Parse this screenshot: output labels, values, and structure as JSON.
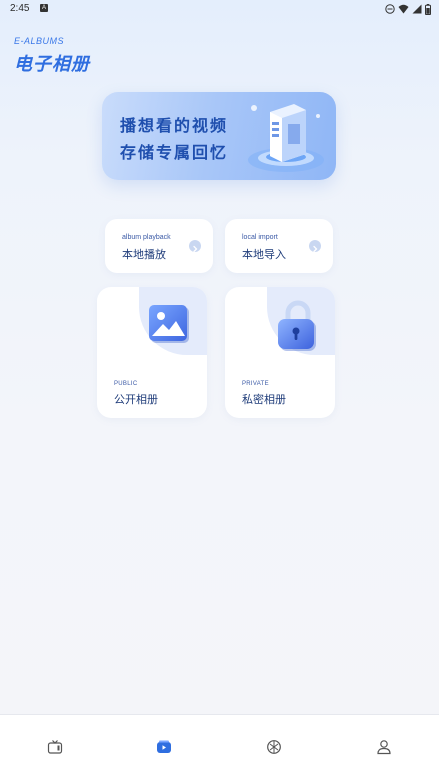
{
  "status_bar": {
    "time": "2:45",
    "notification_icon": "a-icon",
    "icons": [
      "dnd-icon",
      "wifi-icon",
      "signal-icon",
      "battery-icon"
    ]
  },
  "header": {
    "brand_en": "E-ALBUMS",
    "brand_cn": "电子相册"
  },
  "banner": {
    "line1": "播想看的视频",
    "line2": "存储专属回忆"
  },
  "quick_actions": [
    {
      "en": "album playback",
      "cn": "本地播放",
      "icon": "chevron-right-icon"
    },
    {
      "en": "local import",
      "cn": "本地导入",
      "icon": "chevron-right-icon"
    }
  ],
  "albums": [
    {
      "en": "PUBLIC",
      "cn": "公开相册",
      "icon": "image-icon"
    },
    {
      "en": "PRIVATE",
      "cn": "私密相册",
      "icon": "padlock-icon"
    }
  ],
  "bottom_nav": [
    {
      "name": "tv",
      "icon": "tv-icon",
      "active": false
    },
    {
      "name": "album",
      "icon": "album-icon",
      "active": true
    },
    {
      "name": "discover",
      "icon": "aperture-icon",
      "active": false
    },
    {
      "name": "profile",
      "icon": "user-icon",
      "active": false
    }
  ],
  "colors": {
    "accent": "#2f6ee0",
    "text_dark": "#1f3c7a",
    "card_bg": "#ffffff",
    "page_bg": "#f4f5f9"
  }
}
